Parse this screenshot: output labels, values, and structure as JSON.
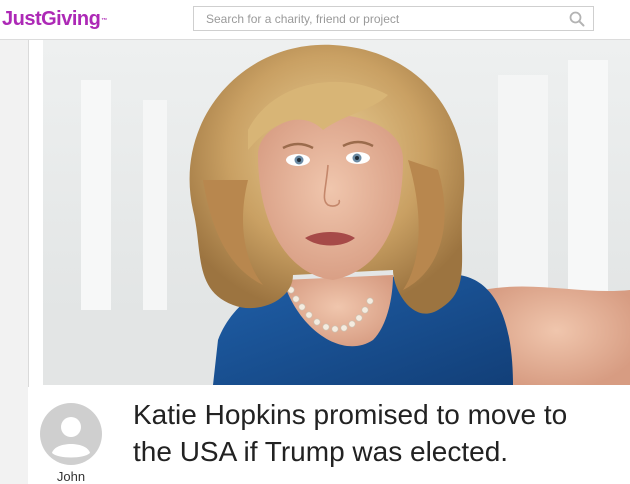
{
  "header": {
    "logo_text": "JustGiving",
    "logo_mark": "™",
    "brand_color": "#ad29b6",
    "search": {
      "placeholder": "Search for a charity, friend or project",
      "icon": "search-icon"
    }
  },
  "story": {
    "owner_name": "John",
    "avatar_icon": "default-user-avatar-icon",
    "title": "Katie Hopkins promised to move to the USA if Trump was elected."
  }
}
